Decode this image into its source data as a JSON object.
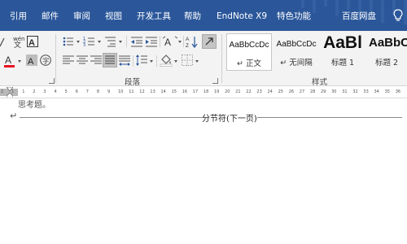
{
  "menu": {
    "tabs": [
      {
        "label": "引用"
      },
      {
        "label": "邮件"
      },
      {
        "label": "审阅"
      },
      {
        "label": "视图"
      },
      {
        "label": "开发工具"
      },
      {
        "label": "帮助"
      },
      {
        "label": "EndNote X9"
      },
      {
        "label": "特色功能"
      },
      {
        "label": "百度网盘"
      }
    ],
    "lightbulb_icon": "lightbulb-icon"
  },
  "ribbon": {
    "font_group": {
      "icons": [
        "phonetic-guide-icon",
        "character-border-icon",
        "font-color-icon",
        "character-shading-icon",
        "enclose-characters-icon"
      ],
      "font_color": "#e81123"
    },
    "paragraph_group": {
      "label": "段落",
      "icons": [
        "bullets-icon",
        "numbering-icon",
        "multilevel-list-icon",
        "decrease-indent-icon",
        "increase-indent-icon",
        "asian-layout-icon",
        "sort-icon",
        "show-marks-icon",
        "align-left-icon",
        "align-center-icon",
        "align-right-icon",
        "justify-icon",
        "distributed-icon",
        "line-spacing-icon",
        "shading-icon",
        "borders-icon"
      ]
    },
    "styles_group": {
      "label": "样式",
      "items": [
        {
          "sample": "AaBbCcDc",
          "name": "↵ 正文",
          "selected": true
        },
        {
          "sample": "AaBbCcDc",
          "name": "↵ 无间隔",
          "selected": false
        },
        {
          "sample": "AaBl",
          "name": "标题 1",
          "selected": false
        },
        {
          "sample": "AaBbC",
          "name": "标题 2",
          "selected": false
        }
      ]
    }
  },
  "ruler": {
    "numbers": [
      "2",
      "1",
      "1",
      "2",
      "3",
      "4",
      "5",
      "6",
      "7",
      "8",
      "9",
      "10",
      "11",
      "12",
      "13",
      "14",
      "15",
      "16",
      "17",
      "18",
      "19",
      "20",
      "21",
      "22",
      "23",
      "24",
      "25",
      "26",
      "27",
      "28",
      "29",
      "30",
      "31",
      "32",
      "33",
      "34",
      "35",
      "36"
    ]
  },
  "document": {
    "partial_text": "思考题。",
    "return_mark": "↵",
    "section_break_label": "分节符(下一页)"
  },
  "colors": {
    "accent": "#2b579a",
    "ribbon_bg": "#f3f3f3",
    "selected_button_bg": "#c5c5c5"
  }
}
